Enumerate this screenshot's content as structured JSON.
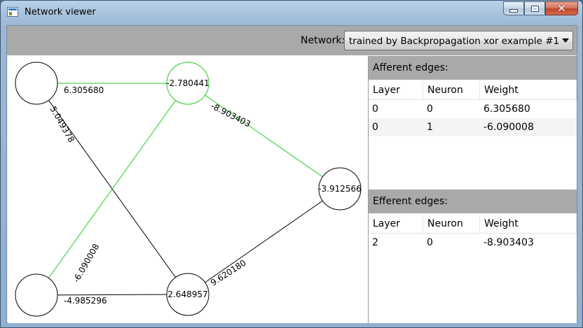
{
  "window": {
    "title": "Network viewer",
    "close_glyph": "✕"
  },
  "toolbar": {
    "network_label": "Network:",
    "network_selected": "trained by Backpropagation xor example #1"
  },
  "graph": {
    "nodes": [
      {
        "id": "in0",
        "label": ""
      },
      {
        "id": "in1",
        "label": ""
      },
      {
        "id": "h0",
        "label": "-2.780441"
      },
      {
        "id": "h1",
        "label": "2.648957"
      },
      {
        "id": "out0",
        "label": "-3.912566"
      }
    ],
    "edges": [
      {
        "from": "in0",
        "to": "h0",
        "weight": "6.305680",
        "highlight": true
      },
      {
        "from": "in0",
        "to": "h1",
        "weight": "5.049378",
        "highlight": false
      },
      {
        "from": "in1",
        "to": "h0",
        "weight": "-6.090008",
        "highlight": true
      },
      {
        "from": "in1",
        "to": "h1",
        "weight": "-4.985296",
        "highlight": false
      },
      {
        "from": "h0",
        "to": "out0",
        "weight": "-8.903403",
        "highlight": true
      },
      {
        "from": "h1",
        "to": "out0",
        "weight": "9.620180",
        "highlight": false
      }
    ],
    "colors": {
      "highlight": "#22cc22",
      "normal": "#000000"
    }
  },
  "afferent": {
    "title": "Afferent edges:",
    "columns": [
      "Layer",
      "Neuron",
      "Weight"
    ],
    "rows": [
      [
        "0",
        "0",
        "6.305680"
      ],
      [
        "0",
        "1",
        "-6.090008"
      ]
    ]
  },
  "efferent": {
    "title": "Efferent edges:",
    "columns": [
      "Layer",
      "Neuron",
      "Weight"
    ],
    "rows": [
      [
        "2",
        "0",
        "-8.903403"
      ]
    ]
  }
}
